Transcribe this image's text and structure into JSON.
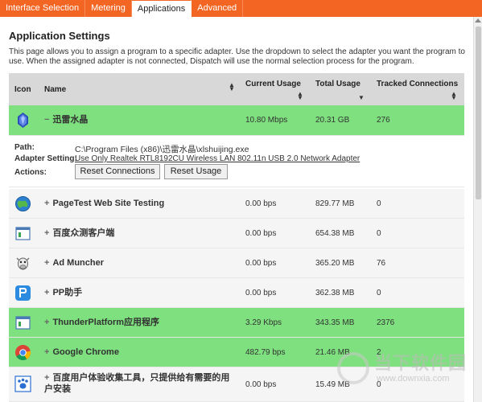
{
  "tabs": [
    {
      "label": "Interface Selection"
    },
    {
      "label": "Metering"
    },
    {
      "label": "Applications"
    },
    {
      "label": "Advanced"
    }
  ],
  "page": {
    "title": "Application Settings",
    "description": "This page allows you to assign a program to a specific adapter. Use the dropdown to select the adapter you want the program to use. When the assigned adapter is not connected, Dispatch will use the normal selection process for the program."
  },
  "table": {
    "headers": {
      "icon": "Icon",
      "name": "Name",
      "current": "Current Usage",
      "total": "Total Usage",
      "tracked": "Tracked Connections"
    },
    "rows": [
      {
        "name": "迅雷水晶",
        "toggle": "−",
        "current": "10.80 Mbps",
        "total": "20.31 GB",
        "tracked": "276",
        "highlight": true,
        "icon": "crystal-icon"
      },
      {
        "name": "PageTest Web Site Testing",
        "toggle": "+",
        "current": "0.00 bps",
        "total": "829.77 MB",
        "tracked": "0",
        "highlight": false,
        "icon": "globe-icon"
      },
      {
        "name": "百度众测客户端",
        "toggle": "+",
        "current": "0.00 bps",
        "total": "654.38 MB",
        "tracked": "0",
        "highlight": false,
        "icon": "window-icon"
      },
      {
        "name": "Ad Muncher",
        "toggle": "+",
        "current": "0.00 bps",
        "total": "365.20 MB",
        "tracked": "76",
        "highlight": false,
        "icon": "cow-icon"
      },
      {
        "name": "PP助手",
        "toggle": "+",
        "current": "0.00 bps",
        "total": "362.38 MB",
        "tracked": "0",
        "highlight": false,
        "icon": "pp-icon"
      },
      {
        "name": "ThunderPlatform应用程序",
        "toggle": "+",
        "current": "3.29 Kbps",
        "total": "343.35 MB",
        "tracked": "2376",
        "highlight": true,
        "icon": "window-icon"
      },
      {
        "name": "Google Chrome",
        "toggle": "+",
        "current": "482.79 bps",
        "total": "21.46 MB",
        "tracked": "2",
        "highlight": true,
        "icon": "chrome-icon"
      },
      {
        "name": "百度用户体验收集工具，只提供给有需要的用户安装",
        "toggle": "+",
        "current": "0.00 bps",
        "total": "15.49 MB",
        "tracked": "0",
        "highlight": false,
        "icon": "paw-icon"
      }
    ]
  },
  "detail": {
    "path_label": "Path:",
    "path_value": "C:\\Program Files (x86)\\迅雷水晶\\xlshuijing.exe",
    "adapter_label": "Adapter Setting:",
    "adapter_value": "Use Only Realtek RTL8192CU Wireless LAN 802.11n USB 2.0 Network Adapter",
    "actions_label": "Actions:",
    "reset_connections": "Reset Connections",
    "reset_usage": "Reset Usage"
  },
  "watermark": {
    "text": "当下软件园",
    "url": "www.downxia.com"
  },
  "colors": {
    "tab_bar": "#f26522",
    "highlight_row": "#7ee07e",
    "header_bg": "#d8d8d8"
  }
}
